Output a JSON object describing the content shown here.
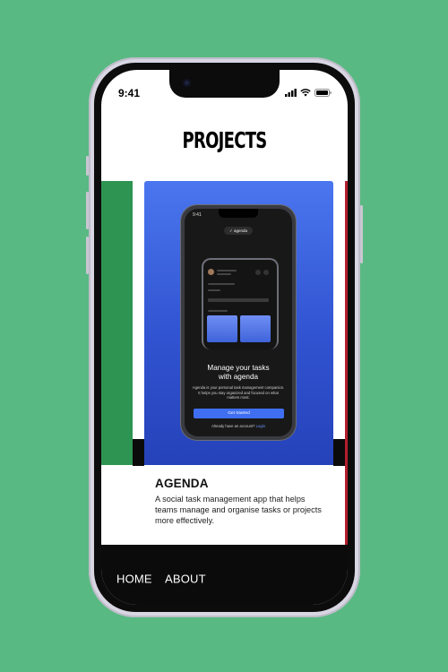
{
  "status_bar": {
    "time": "9:41"
  },
  "app": {
    "title": "PROJECTS"
  },
  "project": {
    "title": "AGENDA",
    "description": "A social task management app that helps teams manage and organise tasks or projects more effectively."
  },
  "mockup": {
    "time": "9:41",
    "logo": "agenda",
    "heading_line1": "Manage your tasks",
    "heading_line2": "with agenda",
    "body": "Agenda is your personal task management companion. It helps you stay organized and focused on what matters most.",
    "button": "Get Started",
    "login_prompt": "Already have an account?",
    "login_link": "Login"
  },
  "nav": {
    "home": "HOME",
    "about": "ABOUT"
  },
  "colors": {
    "background": "#59b982",
    "card_hero": "#3153d1",
    "prev_card": "#2e9452",
    "next_card": "#b41e2e",
    "nav_bar": "#0b0b0b",
    "cta_button": "#3f6ff0"
  },
  "icons": [
    "signal-icon",
    "wifi-icon",
    "battery-icon",
    "agenda-logo-icon"
  ]
}
